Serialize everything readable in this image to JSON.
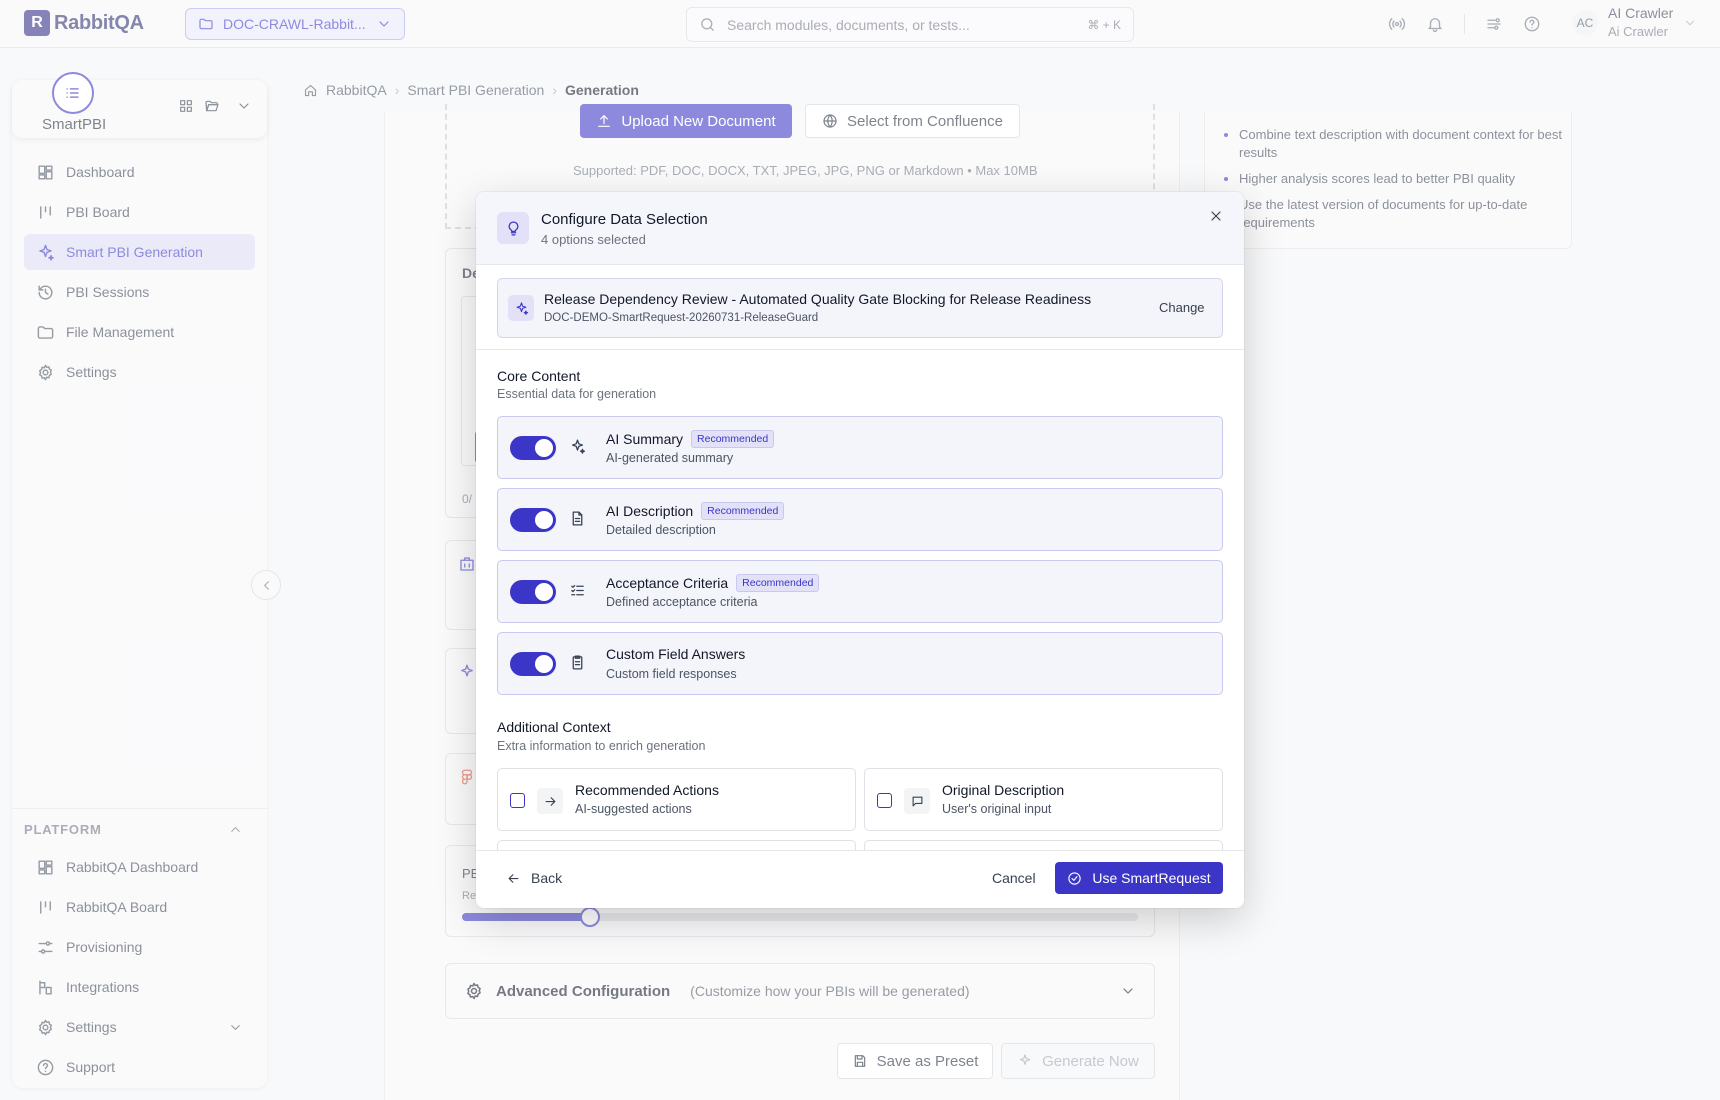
{
  "app": {
    "logo_text": "RabbitQA",
    "logo_letter": "R"
  },
  "header": {
    "project": "DOC-CRAWL-Rabbit...",
    "search_placeholder": "Search modules, documents, or tests...",
    "search_shortcut": "⌘ + K",
    "user": {
      "initials": "AC",
      "name": "AI Crawler",
      "role": "Ai Crawler"
    }
  },
  "sidebar": {
    "brand": "SmartPBI",
    "items": [
      {
        "label": "Dashboard",
        "icon": "dashboard-icon"
      },
      {
        "label": "PBI Board",
        "icon": "board-icon"
      },
      {
        "label": "Smart PBI Generation",
        "icon": "sparkle-icon",
        "active": true
      },
      {
        "label": "PBI Sessions",
        "icon": "history-icon"
      },
      {
        "label": "File Management",
        "icon": "folder-icon"
      },
      {
        "label": "Settings",
        "icon": "gear-icon"
      }
    ],
    "platform_label": "PLATFORM",
    "platform_items": [
      {
        "label": "RabbitQA Dashboard",
        "icon": "dashboard-icon"
      },
      {
        "label": "RabbitQA Board",
        "icon": "board-icon"
      },
      {
        "label": "Provisioning",
        "icon": "sliders-icon"
      },
      {
        "label": "Integrations",
        "icon": "integrations-icon"
      },
      {
        "label": "Settings",
        "icon": "gear-icon"
      },
      {
        "label": "Support",
        "icon": "help-icon"
      }
    ]
  },
  "breadcrumb": [
    "RabbitQA",
    "Smart PBI Generation",
    "Generation"
  ],
  "background": {
    "upload_label": "Upload New Document",
    "confluence_label": "Select from Confluence",
    "supported_text": "Supported: PDF, DOC, DOCX, TXT, JPEG, JPG, PNG or Markdown • Max 10MB",
    "tips": [
      "Combine text description with document context for best results",
      "Higher analysis scores lead to better PBI quality",
      "Use the latest version of documents for up-to-date requirements"
    ],
    "partial_labels": {
      "de": "De",
      "count": "0/",
      "pb": "PB",
      "re": "Re"
    },
    "slider_fraction": 0.19,
    "advanced_title": "Advanced Configuration",
    "advanced_desc": "(Customize how your PBIs will be generated)",
    "save_preset": "Save as Preset",
    "generate_now": "Generate Now"
  },
  "modal": {
    "title": "Configure Data Selection",
    "subtitle": "4 options selected",
    "document": {
      "title": "Release Dependency Review - Automated Quality Gate Blocking for Release Readiness",
      "id": "DOC-DEMO-SmartRequest-20260731-ReleaseGuard",
      "change_label": "Change"
    },
    "core": {
      "title": "Core Content",
      "subtitle": "Essential data for generation",
      "options": [
        {
          "title": "AI Summary",
          "badge": "Recommended",
          "subtitle": "AI-generated summary",
          "enabled": true,
          "icon": "sparkle-icon"
        },
        {
          "title": "AI Description",
          "badge": "Recommended",
          "subtitle": "Detailed description",
          "enabled": true,
          "icon": "document-icon"
        },
        {
          "title": "Acceptance Criteria",
          "badge": "Recommended",
          "subtitle": "Defined acceptance criteria",
          "enabled": true,
          "icon": "checklist-icon"
        },
        {
          "title": "Custom Field Answers",
          "badge": "",
          "subtitle": "Custom field responses",
          "enabled": true,
          "icon": "clipboard-icon"
        }
      ]
    },
    "additional": {
      "title": "Additional Context",
      "subtitle": "Extra information to enrich generation",
      "options": [
        {
          "title": "Recommended Actions",
          "subtitle": "AI-suggested actions",
          "checked": false,
          "icon": "arrow-right-icon"
        },
        {
          "title": "Original Description",
          "subtitle": "User's original input",
          "checked": false,
          "icon": "message-icon"
        }
      ]
    },
    "footer": {
      "back": "Back",
      "cancel": "Cancel",
      "submit": "Use SmartRequest"
    }
  },
  "colors": {
    "accent": "#3b36c7",
    "accent_soft": "#e2e1f7",
    "surface": "#f7f7f9"
  }
}
